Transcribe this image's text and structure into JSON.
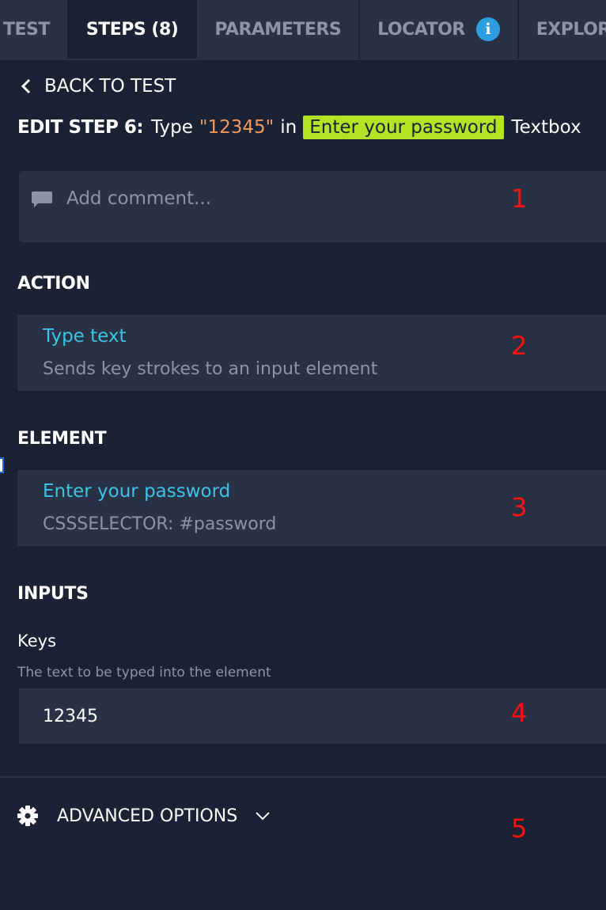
{
  "tabs": [
    {
      "label": "TEST",
      "active": false
    },
    {
      "label": "STEPS (8)",
      "active": true
    },
    {
      "label": "PARAMETERS",
      "active": false
    },
    {
      "label": "LOCATOR",
      "active": false,
      "icon": "info-icon"
    },
    {
      "label": "EXPLORE",
      "active": false
    }
  ],
  "header": {
    "back_label": "BACK TO TEST",
    "edit_label": "EDIT STEP 6:",
    "verb": "Type",
    "value": "\"12345\"",
    "preposition": "in",
    "element": "Enter your password",
    "element_type": "Textbox"
  },
  "comment": {
    "placeholder": "Add comment...",
    "icon": "comment-icon"
  },
  "action": {
    "section_label": "ACTION",
    "name": "Type text",
    "description": "Sends key strokes to an input element"
  },
  "element": {
    "section_label": "ELEMENT",
    "name": "Enter your password",
    "selector": "CSSSELECTOR: #password"
  },
  "inputs": {
    "section_label": "INPUTS",
    "keys_label": "Keys",
    "keys_description": "The text to be typed into the element",
    "keys_value": "12345"
  },
  "advanced": {
    "label": "ADVANCED OPTIONS",
    "icon": "gear-icon"
  },
  "annotations": [
    "1",
    "2",
    "3",
    "4",
    "5"
  ],
  "colors": {
    "background": "#1b2234",
    "panel": "#283244",
    "accent_cyan": "#3cc3e6",
    "value_orange": "#f29b5e",
    "element_highlight": "#b3e324",
    "info_blue": "#2d9fe0",
    "annotation_red": "#ff1010"
  }
}
